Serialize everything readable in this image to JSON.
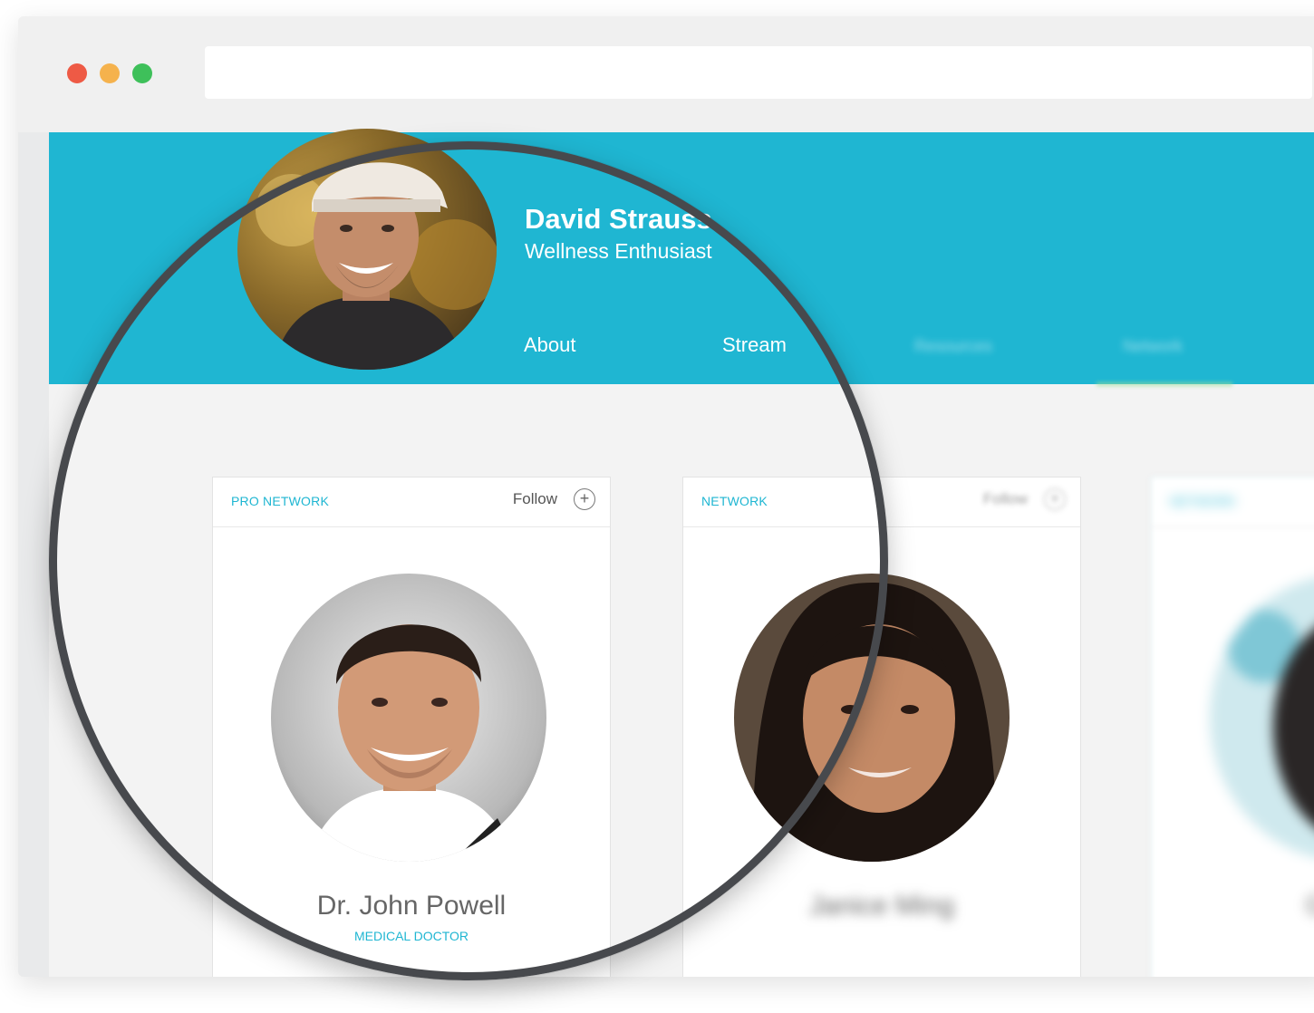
{
  "browser": {
    "window_controls": [
      "close",
      "minimize",
      "zoom"
    ],
    "address": ""
  },
  "profile": {
    "name": "David Strauss",
    "subtitle": "Wellness Enthusiast",
    "avatar_icon": "user-photo"
  },
  "tabs": [
    {
      "label": "About"
    },
    {
      "label": "Stream"
    },
    {
      "label": "Resources"
    },
    {
      "label": "Network"
    }
  ],
  "cards": [
    {
      "tag": "PRO NETWORK",
      "follow_label": "Follow",
      "follow_icon": "plus-circle-icon",
      "name": "Dr. John Powell",
      "role": "MEDICAL DOCTOR"
    },
    {
      "tag": "NETWORK",
      "follow_label": "Follow",
      "name": "Janice Ming",
      "role": ""
    },
    {
      "tag": "NETWORK",
      "name": "Gethun",
      "role": ""
    }
  ],
  "colors": {
    "accent": "#1fb6d2",
    "header_bg": "#1fb6d2",
    "page_bg": "#f3f3f3",
    "magnifier_ring": "#47494d"
  }
}
